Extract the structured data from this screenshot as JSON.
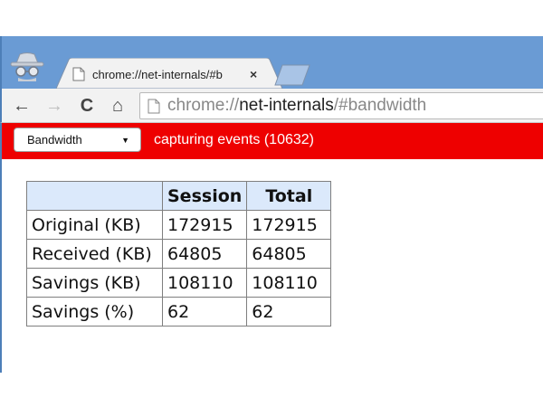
{
  "browser": {
    "tab": {
      "title": "chrome://net-internals/#b",
      "close_glyph": "×",
      "favicon": "page-icon"
    },
    "toolbar": {
      "back_glyph": "←",
      "forward_glyph": "→",
      "reload_glyph": "C",
      "home_glyph": "⌂"
    },
    "omnibox": {
      "scheme": "chrome://",
      "host": "net-internals",
      "path": "/#bandwidth"
    }
  },
  "statusbar": {
    "color": "#ee0000",
    "view_select": {
      "selected": "Bandwidth",
      "arrow": "▼"
    },
    "status_text": "capturing events (10632)"
  },
  "bandwidth_table": {
    "headers": [
      "",
      "Session",
      "Total"
    ],
    "rows": [
      {
        "label": "Original (KB)",
        "session": "172915",
        "total": "172915"
      },
      {
        "label": "Received (KB)",
        "session": "64805",
        "total": "64805"
      },
      {
        "label": "Savings (KB)",
        "session": "108110",
        "total": "108110"
      },
      {
        "label": "Savings (%)",
        "session": "62",
        "total": "62"
      }
    ]
  },
  "colors": {
    "titlebar": "#6a9bd4",
    "header_cell": "#dbe9fb"
  }
}
